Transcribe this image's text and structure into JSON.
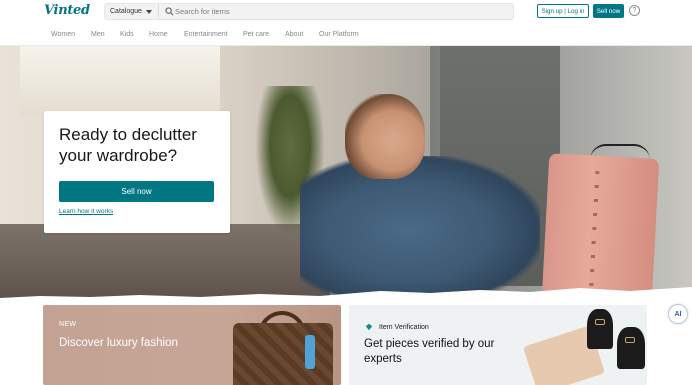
{
  "header": {
    "logo_text": "Vinted",
    "catalogue_label": "Catalogue",
    "search_placeholder": "Search for items",
    "signup_label": "Sign up | Log in",
    "sell_now_label": "Sell now",
    "help_symbol": "?"
  },
  "nav": {
    "items": [
      {
        "label": "Women"
      },
      {
        "label": "Men"
      },
      {
        "label": "Kids"
      },
      {
        "label": "Home"
      },
      {
        "label": "Entertainment"
      },
      {
        "label": "Pet care"
      },
      {
        "label": "About"
      },
      {
        "label": "Our Platform"
      }
    ]
  },
  "hero": {
    "title": "Ready to declutter your wardrobe?",
    "sell_button": "Sell now",
    "learn_link": "Learn how it works"
  },
  "cards": {
    "left": {
      "tag": "NEW",
      "title": "Discover luxury fashion"
    },
    "right": {
      "tag": "Item Verification",
      "title": "Get pieces verified by our experts"
    }
  },
  "ai_badge": {
    "label": "AI"
  },
  "colors": {
    "brand": "#007782",
    "hero_card_bg": "#ffffff",
    "left_card_bg": "#c4a293",
    "right_card_bg": "#eef2f2"
  },
  "icons": {
    "search": "search-icon",
    "caret": "chevron-down-icon",
    "help": "help-icon",
    "verification": "diamond-icon"
  }
}
